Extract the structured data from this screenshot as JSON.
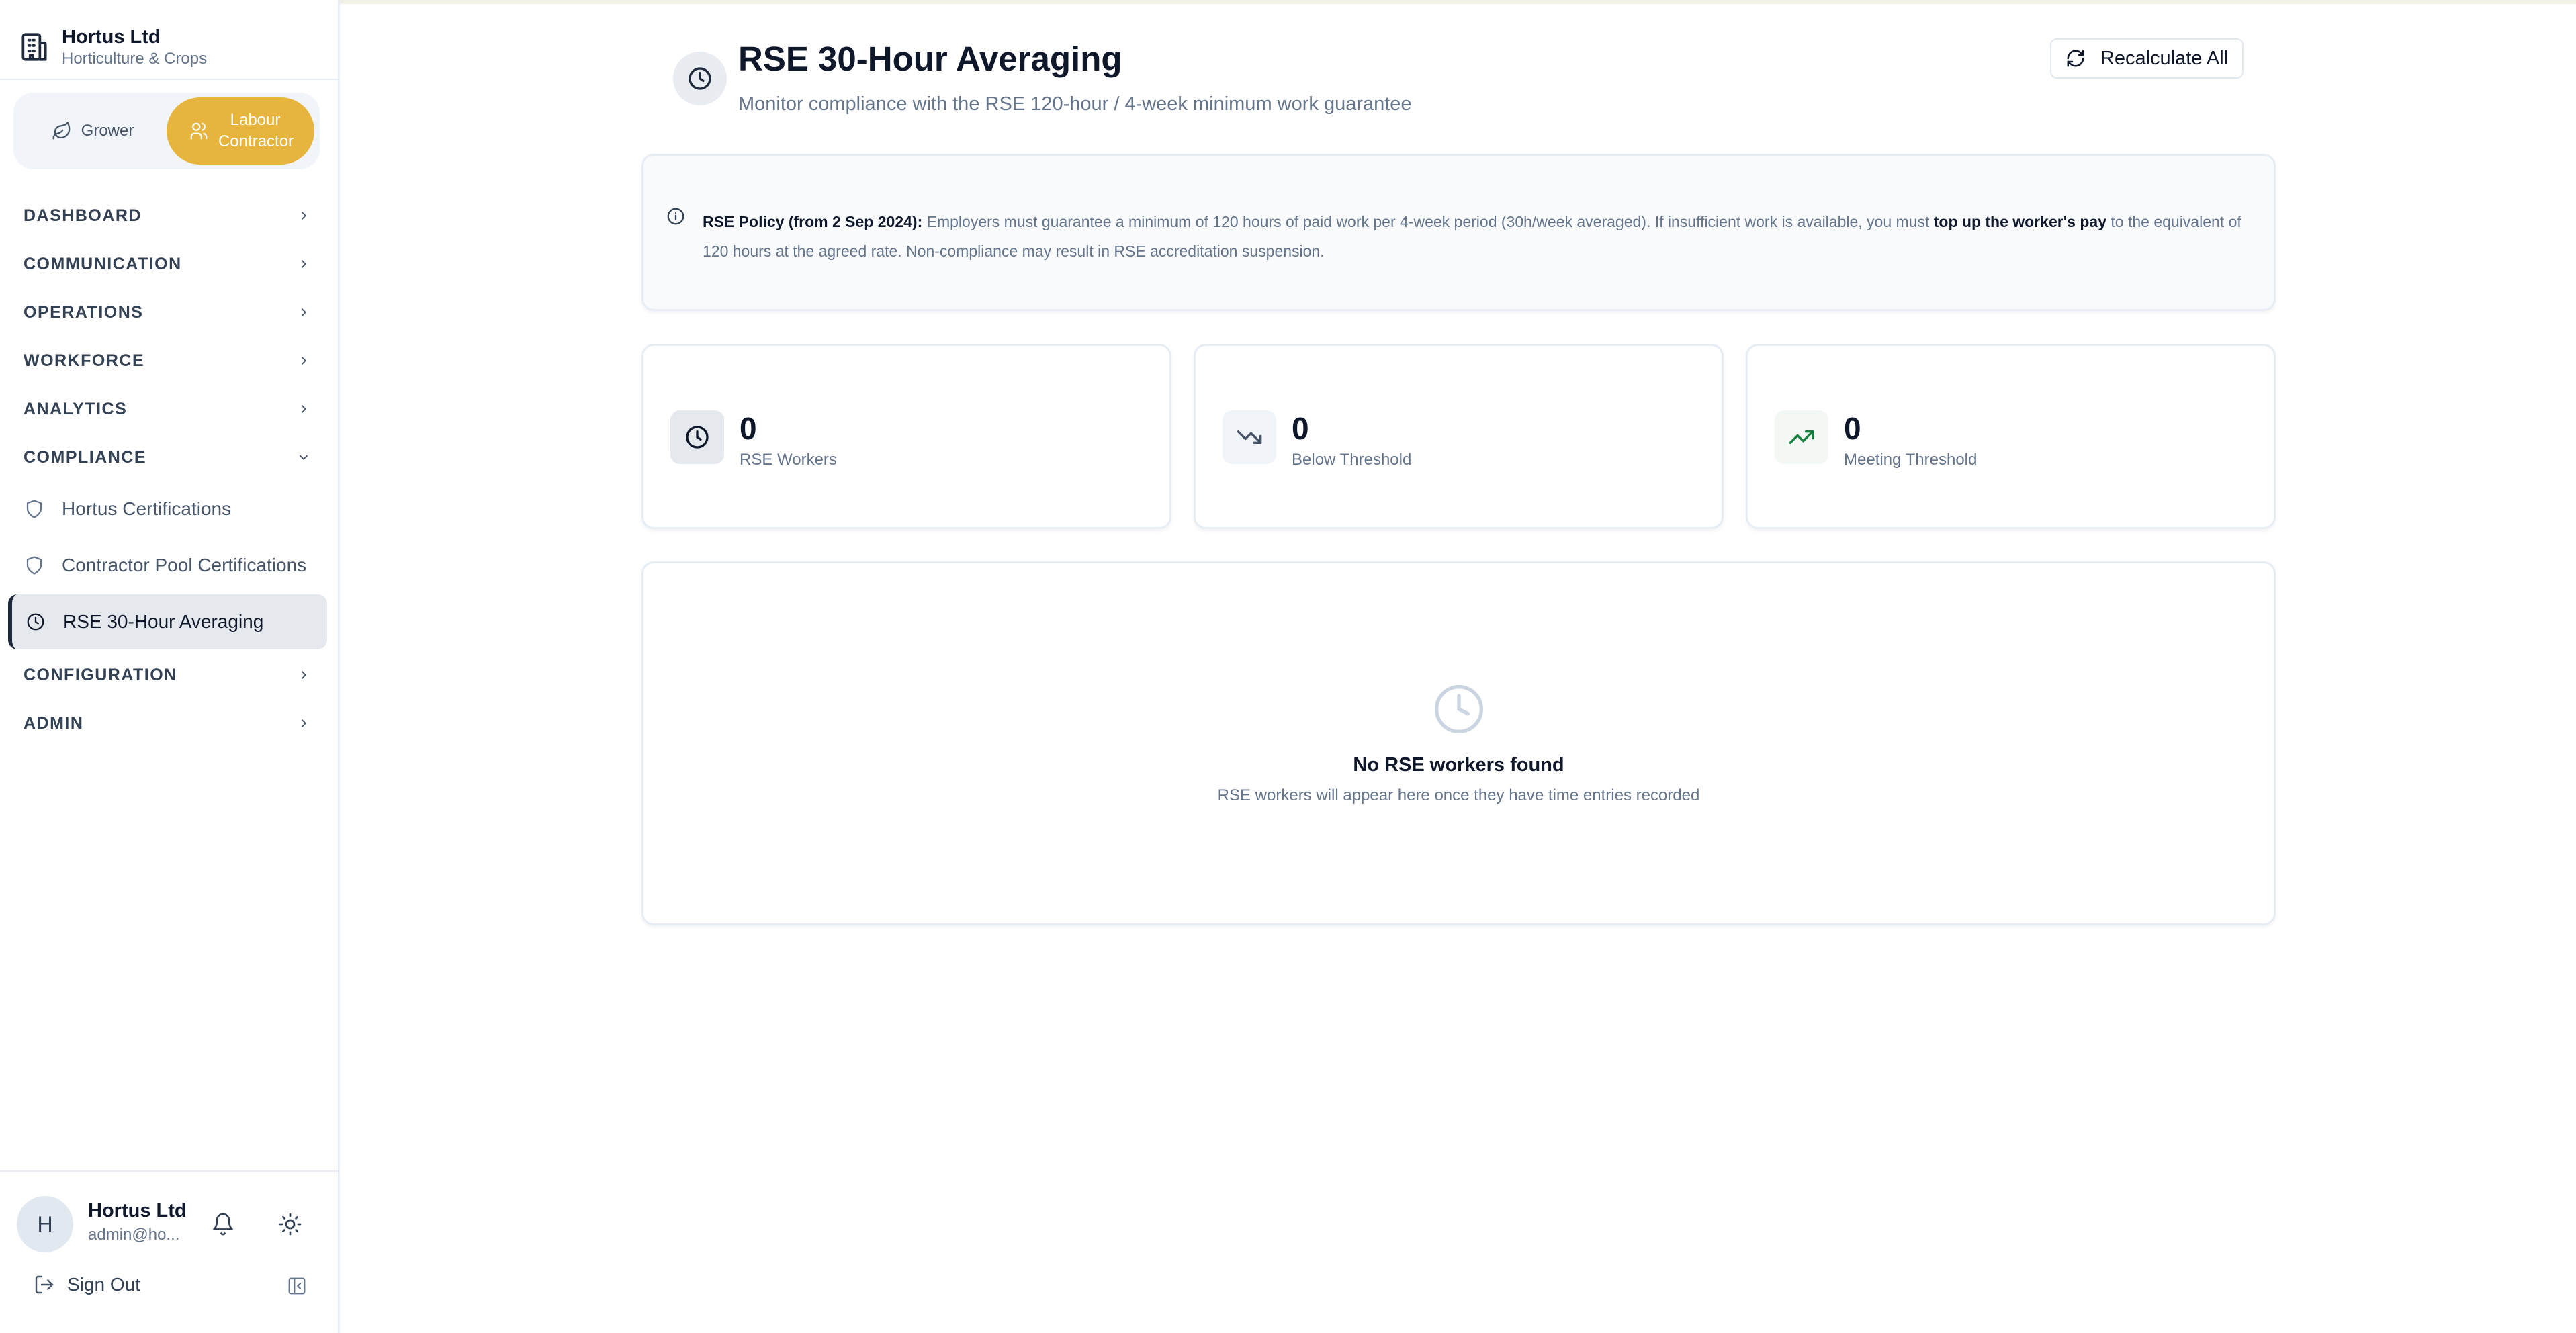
{
  "brand": {
    "name": "Hortus Ltd",
    "subtitle": "Horticulture & Crops"
  },
  "mode_switch": {
    "grower_label": "Grower",
    "contractor_label": "Labour Contractor",
    "active": "Labour Contractor"
  },
  "sidebar": {
    "sections": [
      {
        "label": "DASHBOARD"
      },
      {
        "label": "COMMUNICATION"
      },
      {
        "label": "OPERATIONS"
      },
      {
        "label": "WORKFORCE"
      },
      {
        "label": "ANALYTICS"
      },
      {
        "label": "COMPLIANCE"
      },
      {
        "label": "CONFIGURATION"
      },
      {
        "label": "ADMIN"
      }
    ],
    "compliance_items": [
      {
        "label": "Hortus Certifications",
        "icon": "shield-icon"
      },
      {
        "label": "Contractor Pool Certifications",
        "icon": "shield-icon"
      },
      {
        "label": "RSE 30-Hour Averaging",
        "icon": "clock-icon",
        "active": true
      }
    ]
  },
  "user": {
    "initial": "H",
    "name": "Hortus Ltd",
    "email": "admin@ho...",
    "signout_label": "Sign Out"
  },
  "page": {
    "title": "RSE 30-Hour Averaging",
    "subtitle": "Monitor compliance with the RSE 120-hour / 4-week minimum work guarantee",
    "recalc_label": "Recalculate All"
  },
  "policy": {
    "bold_lead": "RSE Policy (from 2 Sep 2024):",
    "text_1": " Employers must guarantee a minimum of 120 hours of paid work per 4-week period (30h/week averaged). If insufficient work is available, you must ",
    "bold_mid": "top up the worker's pay",
    "text_2": " to the equivalent of 120 hours at the agreed rate. Non-compliance may result in RSE accreditation suspension."
  },
  "stats": [
    {
      "value": "0",
      "label": "RSE Workers",
      "icon": "clock-icon"
    },
    {
      "value": "0",
      "label": "Below Threshold",
      "icon": "trending-down-icon"
    },
    {
      "value": "0",
      "label": "Meeting Threshold",
      "icon": "trending-up-icon"
    }
  ],
  "empty_state": {
    "title": "No RSE workers found",
    "subtitle": "RSE workers will appear here once they have time entries recorded"
  },
  "colors": {
    "accent": "#e7b53d",
    "success": "#15803d",
    "text": "#0f172a",
    "muted": "#64748b"
  }
}
